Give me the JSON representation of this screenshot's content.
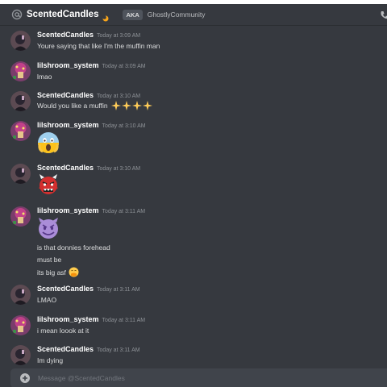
{
  "header": {
    "title": "ScentedCandles",
    "aka_badge": "AKA",
    "aka_name": "GhostlyCommunity"
  },
  "messages": [
    {
      "author": "ScentedCandles",
      "time": "Today at 3:09 AM",
      "lines": [
        "Youre saying that like I'm the muffin man"
      ]
    },
    {
      "author": "lilshroom_system",
      "time": "Today at 3:09 AM",
      "lines": [
        "lmao"
      ]
    },
    {
      "author": "ScentedCandles",
      "time": "Today at 3:10 AM",
      "lines": [
        "Would you like a muffin"
      ],
      "emoji": "sparkles-x4"
    },
    {
      "author": "lilshroom_system",
      "time": "Today at 3:10 AM",
      "emoji": "screaming-face"
    },
    {
      "author": "ScentedCandles",
      "time": "Today at 3:10 AM",
      "emoji": "ogre-face"
    },
    {
      "author": "lilshroom_system",
      "time": "Today at 3:11 AM",
      "emoji": "smiling-imp",
      "lines": [
        "is that donnies forehead",
        "must be",
        "its big asf"
      ],
      "trailing_emoji": "hand-over-mouth"
    },
    {
      "author": "ScentedCandles",
      "time": "Today at 3:11 AM",
      "lines": [
        "LMAO"
      ]
    },
    {
      "author": "lilshroom_system",
      "time": "Today at 3:11 AM",
      "lines": [
        "i mean loook at it"
      ]
    },
    {
      "author": "ScentedCandles",
      "time": "Today at 3:11 AM",
      "lines": [
        "Im dying"
      ]
    }
  ],
  "composer": {
    "placeholder": "Message @ScentedCandles"
  },
  "colors": {
    "background": "#36393f",
    "composer": "#40444b",
    "timestamp": "#8e9297",
    "text": "#dcddde"
  }
}
